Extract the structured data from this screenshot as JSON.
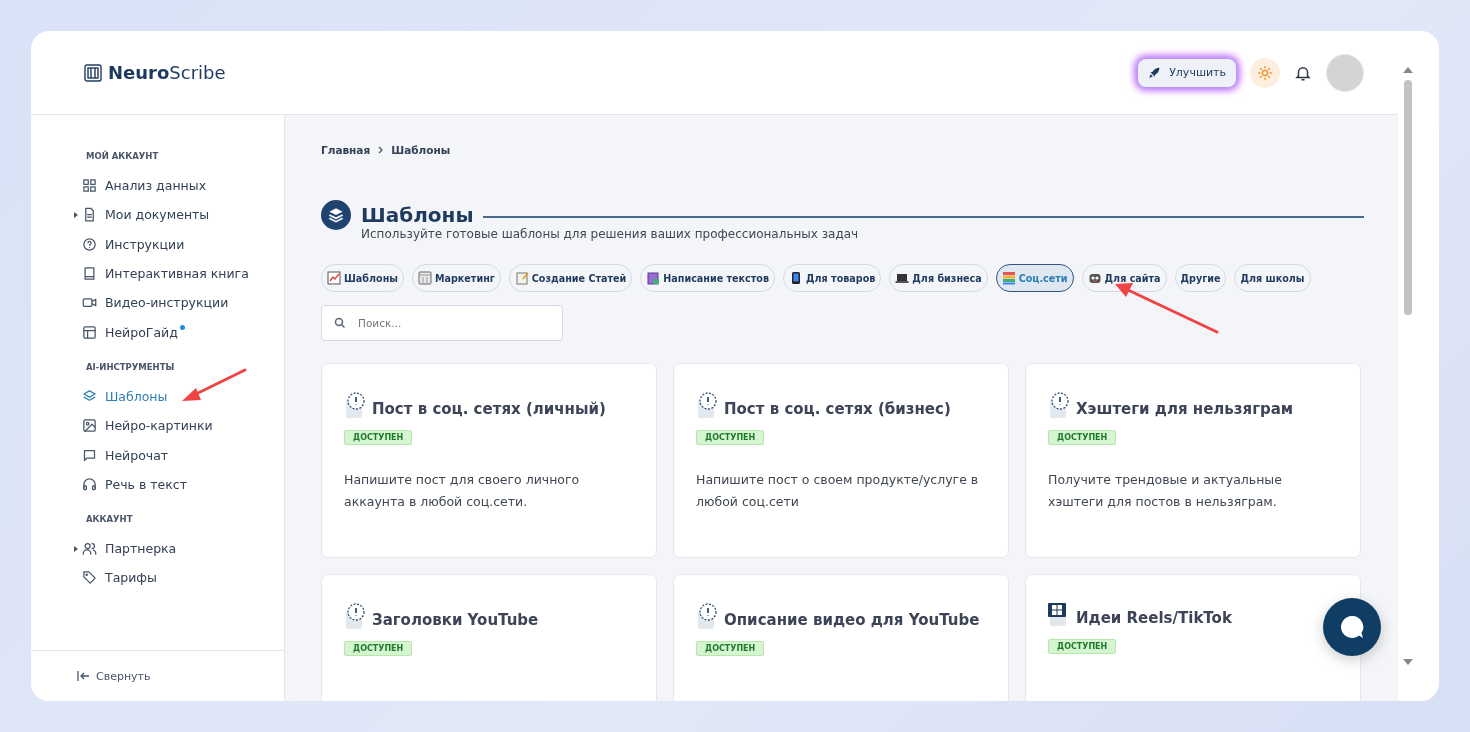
{
  "logo": {
    "bold": "Neuro",
    "light": "Scribe"
  },
  "header": {
    "upgrade_button": "Улучшить"
  },
  "sidebar": {
    "sections": [
      {
        "title": "МОЙ АККАУНТ",
        "items": [
          {
            "label": "Анализ данных",
            "expandable": false,
            "selected": false,
            "dot": false
          },
          {
            "label": "Мои документы",
            "expandable": true,
            "selected": false,
            "dot": false
          },
          {
            "label": "Инструкции",
            "expandable": false,
            "selected": false,
            "dot": false
          },
          {
            "label": "Интерактивная книга",
            "expandable": false,
            "selected": false,
            "dot": false
          },
          {
            "label": "Видео-инструкции",
            "expandable": false,
            "selected": false,
            "dot": false
          },
          {
            "label": "НейроГайд",
            "expandable": false,
            "selected": false,
            "dot": true
          }
        ]
      },
      {
        "title": "AI-ИНСТРУМЕНТЫ",
        "items": [
          {
            "label": "Шаблоны",
            "expandable": false,
            "selected": true,
            "dot": false
          },
          {
            "label": "Нейро-картинки",
            "expandable": false,
            "selected": false,
            "dot": false
          },
          {
            "label": "Нейрочат",
            "expandable": false,
            "selected": false,
            "dot": false
          },
          {
            "label": "Речь в текст",
            "expandable": false,
            "selected": false,
            "dot": false
          }
        ]
      },
      {
        "title": "АККАУНТ",
        "items": [
          {
            "label": "Партнерка",
            "expandable": true,
            "selected": false,
            "dot": false
          },
          {
            "label": "Тарифы",
            "expandable": false,
            "selected": false,
            "dot": false
          }
        ]
      }
    ],
    "collapse": "Свернуть"
  },
  "breadcrumb": [
    "Главная",
    "Шаблоны"
  ],
  "page": {
    "title": "Шаблоны",
    "subtitle": "Используйте готовые шаблоны для решения ваших профессиональных задач"
  },
  "categories": [
    {
      "label": "Шаблоны",
      "selected": false
    },
    {
      "label": "Маркетинг",
      "selected": false
    },
    {
      "label": "Создание Статей",
      "selected": false
    },
    {
      "label": "Написание текстов",
      "selected": false
    },
    {
      "label": "Для товаров",
      "selected": false
    },
    {
      "label": "Для бизнеса",
      "selected": false
    },
    {
      "label": "Соц.сети",
      "selected": true
    },
    {
      "label": "Для сайта",
      "selected": false
    },
    {
      "label": "Другие",
      "selected": false
    },
    {
      "label": "Для школы",
      "selected": false
    }
  ],
  "search": {
    "placeholder": "Поиск..."
  },
  "cards": [
    {
      "kind": "notice",
      "title": "Пост в соц. сетях (личный)",
      "badge": "ДОСТУПЕН",
      "description": "Напишите пост для своего личного аккаунта в любой соц.сети."
    },
    {
      "kind": "notice",
      "title": "Пост в соц. сетях (бизнес)",
      "badge": "ДОСТУПЕН",
      "description": "Напишите пост о своем продукте/услуге в любой соц.сети"
    },
    {
      "kind": "notice",
      "title": "Хэштеги для нельзяграм",
      "badge": "ДОСТУПЕН",
      "description": "Получите трендовые и актуальные хэштеги для постов в нельзяграм."
    },
    {
      "kind": "notice",
      "title": "Заголовки YouTube",
      "badge": "ДОСТУПЕН"
    },
    {
      "kind": "notice",
      "title": "Описание видео для YouTube",
      "badge": "ДОСТУПЕН"
    },
    {
      "kind": "film",
      "title": "Идеи Reels/TikTok",
      "badge": "ДОСТУПЕН"
    }
  ]
}
